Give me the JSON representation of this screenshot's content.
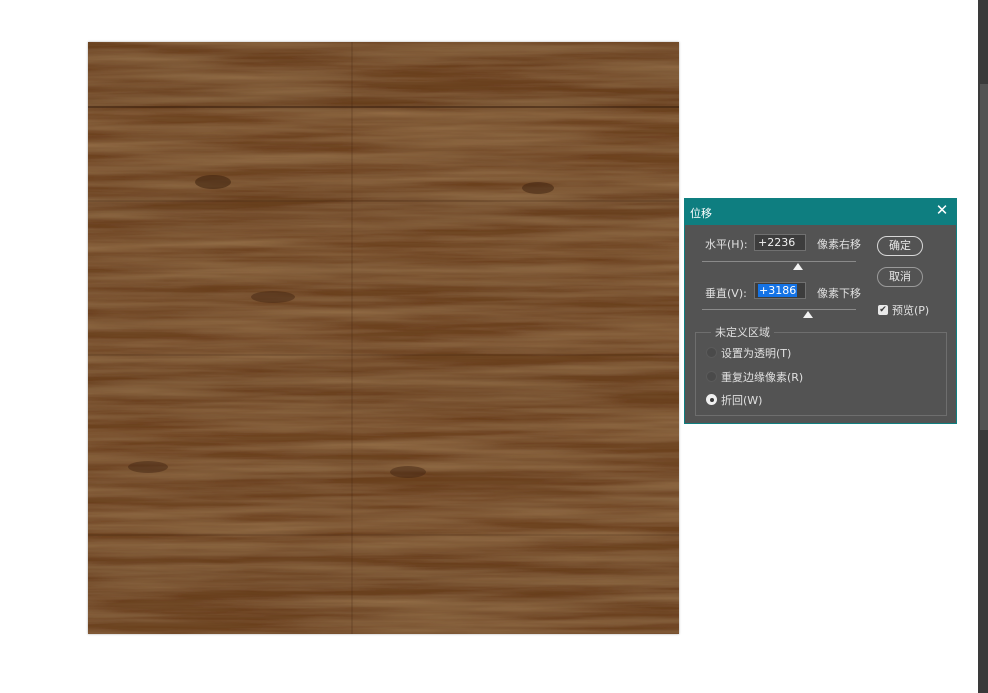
{
  "dialog": {
    "title": "位移",
    "close_icon": "close-icon",
    "horizontal": {
      "label": "水平(H):",
      "value": "+2236",
      "unit": "像素右移"
    },
    "vertical": {
      "label": "垂直(V):",
      "value": "+3186",
      "unit": "像素下移"
    },
    "ok_label": "确定",
    "cancel_label": "取消",
    "preview": {
      "label": "预览(P)",
      "checked": true
    },
    "undefined_area": {
      "title": "未定义区域",
      "options": [
        {
          "label": "设置为透明(T)",
          "selected": false
        },
        {
          "label": "重复边缘像素(R)",
          "selected": false
        },
        {
          "label": "折回(W)",
          "selected": true
        }
      ]
    }
  },
  "colors": {
    "title_bar": "#0e7e80",
    "panel": "#535353",
    "selection": "#1473e6",
    "wood_dark": "#4a2a12",
    "wood_mid": "#6b3f1d",
    "wood_light": "#8a5a2e"
  }
}
